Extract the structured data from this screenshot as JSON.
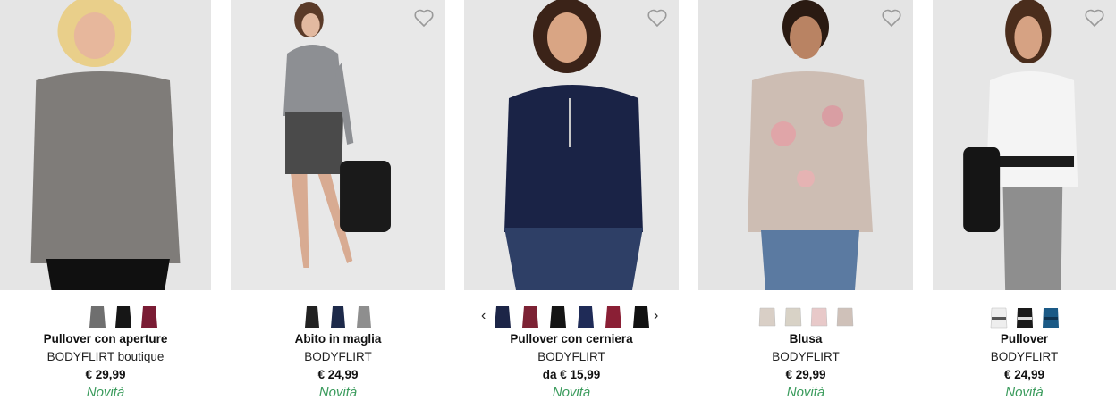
{
  "products": [
    {
      "name": "Abito in maglia",
      "brand": "BODYFLIRT",
      "price": "€ 24,99",
      "badge": "Novità",
      "swatches": [
        "#222222",
        "#1d2a4a",
        "#8e8e8e"
      ]
    },
    {
      "name": "Pullover con cerniera",
      "brand": "BODYFLIRT",
      "price": "da € 15,99",
      "badge": "Novità",
      "swatches": [
        "#1c2547",
        "#7c2234",
        "#141414",
        "#1f2b57",
        "#8a1f35",
        "#111111"
      ]
    },
    {
      "name": "Blusa",
      "brand": "BODYFLIRT",
      "price": "€ 29,99",
      "badge": "Novità",
      "swatches": [
        "#d9cfc6",
        "#d8d2c6",
        "#e8c9c9",
        "#cfc1b9"
      ]
    },
    {
      "name": "Pullover",
      "brand": "BODYFLIRT",
      "price": "€ 24,99",
      "badge": "Novità",
      "swatches": [
        "#eeeeee",
        "#1a1a1a",
        "#1b5a86"
      ]
    },
    {
      "name": "Pullover con aperture",
      "brand": "BODYFLIRT boutique",
      "price": "€ 29,99",
      "badge": "Novità",
      "swatches": [
        "#6f6f6f",
        "#161616",
        "#7a1c34"
      ]
    }
  ],
  "colors": {
    "badge": "#3a9b5c",
    "photo_bg": "#e7e7e7"
  }
}
